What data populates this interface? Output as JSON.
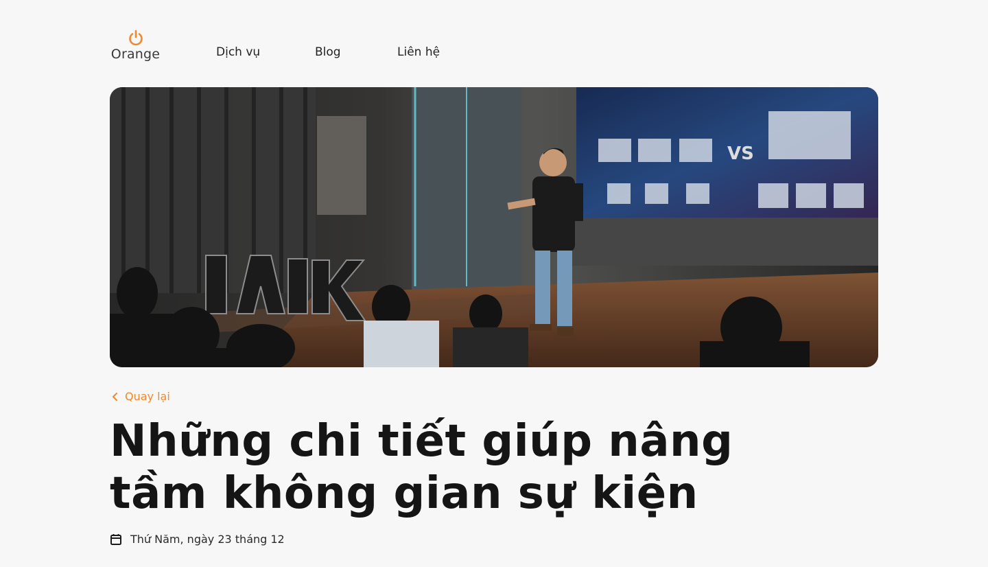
{
  "brand": {
    "name": "Orange",
    "accent": "#f0882c"
  },
  "nav": {
    "items": [
      "Dịch vụ",
      "Blog",
      "Liên hệ"
    ]
  },
  "article": {
    "back_label": "Quay lại",
    "title": "Những chi tiết giúp nâng tầm không gian sự kiện",
    "date": "Thứ Năm, ngày 23 tháng 12",
    "hero_image": "event-talk-stage-photo"
  }
}
